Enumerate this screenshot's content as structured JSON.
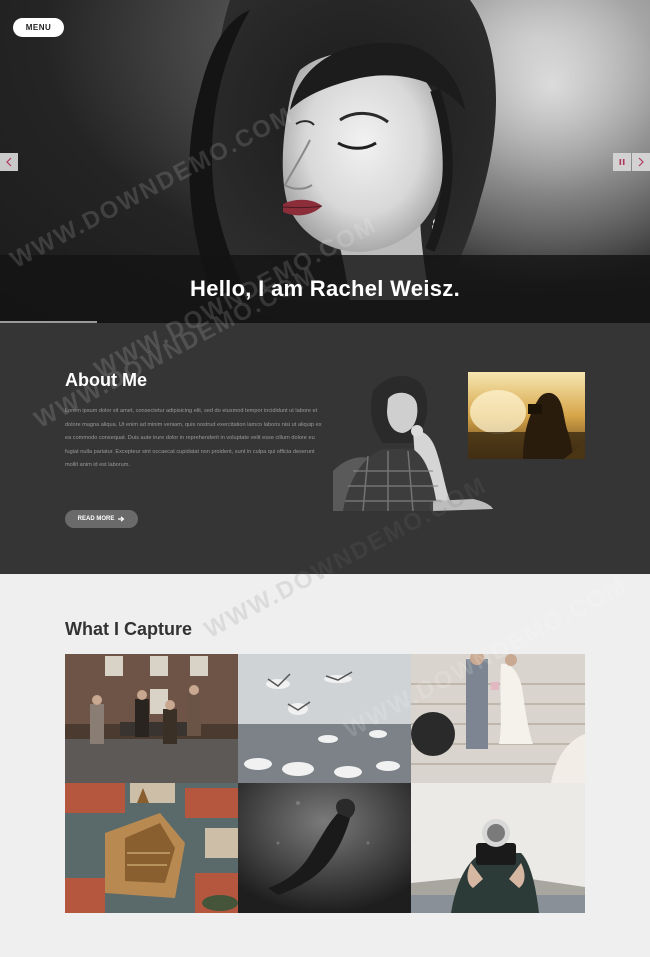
{
  "header": {
    "menu_label": "MENU"
  },
  "hero": {
    "title": "Hello, I am Rachel Weisz.",
    "prev_icon": "chevron-left-icon",
    "pause_icon": "pause-icon",
    "next_icon": "chevron-right-icon"
  },
  "about": {
    "title": "About Me",
    "body": "Lorem ipsum dolor sit amet, consectetur adipisicing elit, sed do eiusmod tempor incididunt ut labore et dolore magna aliqua. Ut enim ad minim veniam, quis nostrud exercitation lamco laboris nisi ut aliquip ex ea commodo consequat. Duis aute irure dolor in reprehenderit in voluptate velit esse cillum dolore eu fugiat nulla pariatur. Excepteur sint occaecat cupidatat non proident, sunt in culpa qui officia deserunt mollit anim id est laborum.",
    "read_more_label": "READ MORE",
    "read_more_icon": "arrow-right-icon"
  },
  "capture": {
    "title": "What I Capture"
  },
  "watermarks": [
    "WWW.DOWNDEMO.COM"
  ],
  "colors": {
    "about_bg": "#353535",
    "page_bg": "#efefef",
    "accent_pink": "#c0395a"
  }
}
